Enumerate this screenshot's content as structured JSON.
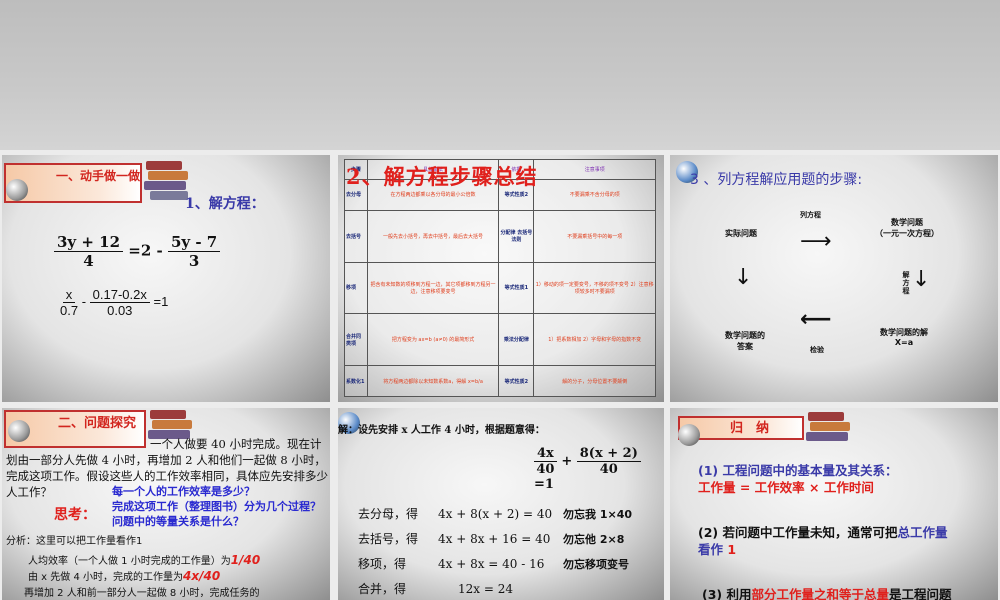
{
  "slide1": {
    "title": "一、动手做一做",
    "subtitle": "1、解方程：",
    "eq1": {
      "num1": "3y + 12",
      "den1": "4",
      "mid": "=2 -",
      "num2": "5y - 7",
      "den2": "3"
    },
    "eq2": {
      "num1": "x",
      "den1": "0.7",
      "mid": "-",
      "num2": "0.17-0.2x",
      "den2": "0.03",
      "rhs": "=1"
    }
  },
  "slide2": {
    "title": "2、解方程步骤总结",
    "headers": [
      "步骤",
      "具体做法",
      "依据",
      "注意事项"
    ],
    "rows": [
      [
        "去分母",
        "在方程两边都乘以各分母的最小公倍数",
        "等式性质2",
        "不要漏乘不含分母的项"
      ],
      [
        "去括号",
        "一般先去小括号，再去中括号，最后去大括号",
        "分配律 去括号法则",
        "不要漏乘括号中的每一项"
      ],
      [
        "移项",
        "把含有未知数的项移到方程一边，其它项都移到方程另一边，注意移项要变号",
        "等式性质1",
        "1）移动的项一定要变号，不移的项不变号 2）注意移项较多时不要漏项"
      ],
      [
        "合并同类项",
        "把方程变为 ax=b (a≠0) 的最简形式",
        "乘法分配律",
        "1）把系数相加 2）字母和字母的指数不变"
      ],
      [
        "系数化1",
        "将方程两边都除以未知数系数a，得解 x=b/a",
        "等式性质2",
        "解的分子，分母位置不要颠倒"
      ]
    ]
  },
  "slide3": {
    "title": "3 、列方程解应用题的步骤:",
    "nodes": {
      "actual": "实际问题",
      "math": "数学问题",
      "math_sub": "（一元一次方程）",
      "solution": "数学问题的解",
      "solution_sub": "X=a",
      "answer": "数学问题的",
      "answer_sub": "答案"
    },
    "edges": {
      "list": "列方程",
      "solve": "解方程",
      "check": "检验"
    }
  },
  "slide4": {
    "title": "二、问题探究",
    "problem": "一个人做要 40 小时完成。现在计划由一部分人先做 4 小时，再增加 2 人和他们一起做 8 小时，完成这项工作。假设这些人的工作效率相同，具体应先安排多少人工作？",
    "think_label": "思考：",
    "q1": "每一个人的工作效率是多少？",
    "q2": "完成这项工作（整理图书）分为几个过程？",
    "q3": "问题中的等量关系是什么？",
    "analysis": "分析：这里可以把工作量看作1",
    "line1": "人均效率（一个人做 1 小时完成的工作量）为",
    "val1": "1/40",
    "line2": "由 x 先做 4 小时，完成的工作量为",
    "val2": "4x/40",
    "line3": "再增加 2 人和前一部分人一起做 8 小时，完成任务的"
  },
  "slide5": {
    "intro": "解：设先安排 x 人工作 4 小时，根据题意得：",
    "eq": {
      "num1": "4x",
      "den1": "40",
      "plus": "+",
      "num2": "8(x + 2)",
      "den2": "40",
      "rhs": "=1"
    },
    "steps": [
      {
        "label": "去分母，得",
        "expr": "4x + 8(x + 2) = 40",
        "note": "勿忘我 1×40"
      },
      {
        "label": "去括号，得",
        "expr": "4x + 8x + 16 = 40",
        "note": "勿忘他 2×8"
      },
      {
        "label": "移项，得",
        "expr": "4x + 8x = 40 - 16",
        "note": "勿忘移项变号"
      },
      {
        "label": "合并，得",
        "expr": "12x = 24",
        "note": ""
      }
    ]
  },
  "slide6": {
    "title": "归　纳",
    "p1": "(1) 工程问题中的基本量及其关系：",
    "p1b": "工作量 = 工作效率 × 工作时间",
    "p2a": "(2) 若问题中工作量未知，通常可把",
    "p2b": "总工作量",
    "p2c": "看作",
    "p2d": "1",
    "p3a": "(3) 利用",
    "p3b": "部分工作量之和等于总量",
    "p3c": "是工程问题"
  }
}
